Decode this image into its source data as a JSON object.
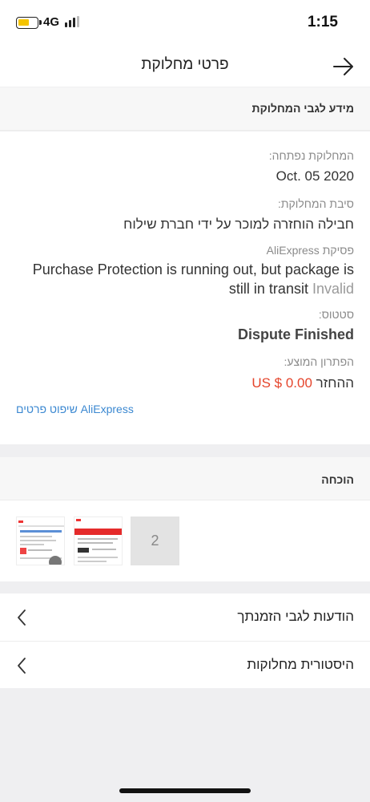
{
  "status_bar": {
    "network": "4G",
    "time": "1:15",
    "battery_color": "#f5c400"
  },
  "nav": {
    "title": "פרטי מחלוקת",
    "back_icon": "arrow-right-icon"
  },
  "dispute_info": {
    "section_title": "מידע לגבי המחלוקת",
    "opened_label": "המחלוקת נפתחה:",
    "opened_value": "Oct. 05 2020",
    "reason_label": "סיבת המחלוקת:",
    "reason_value": "חבילה הוחזרה למוכר על ידי חברת שילוח",
    "ruling_label": "פסיקת AliExpress",
    "ruling_value": "Purchase Protection is running out, but package is still in transit",
    "ruling_status": "Invalid",
    "status_label": "סטטוס:",
    "status_value": "Dispute Finished",
    "solution_label": "הפתרון המוצע:",
    "refund_label": "ההחזר",
    "refund_amount": "US $ 0.00",
    "link_text": "שיפוט פרטים AliExpress",
    "accent_color": "#e5442b",
    "link_color": "#3b88d1"
  },
  "evidence": {
    "section_title": "הוכחה",
    "thumbnails": [
      "evidence-screenshot-1",
      "evidence-screenshot-2"
    ],
    "more_count": "2"
  },
  "links": [
    {
      "label": "הודעות לגבי הזמנתך"
    },
    {
      "label": "היסטורית מחלוקות"
    }
  ]
}
